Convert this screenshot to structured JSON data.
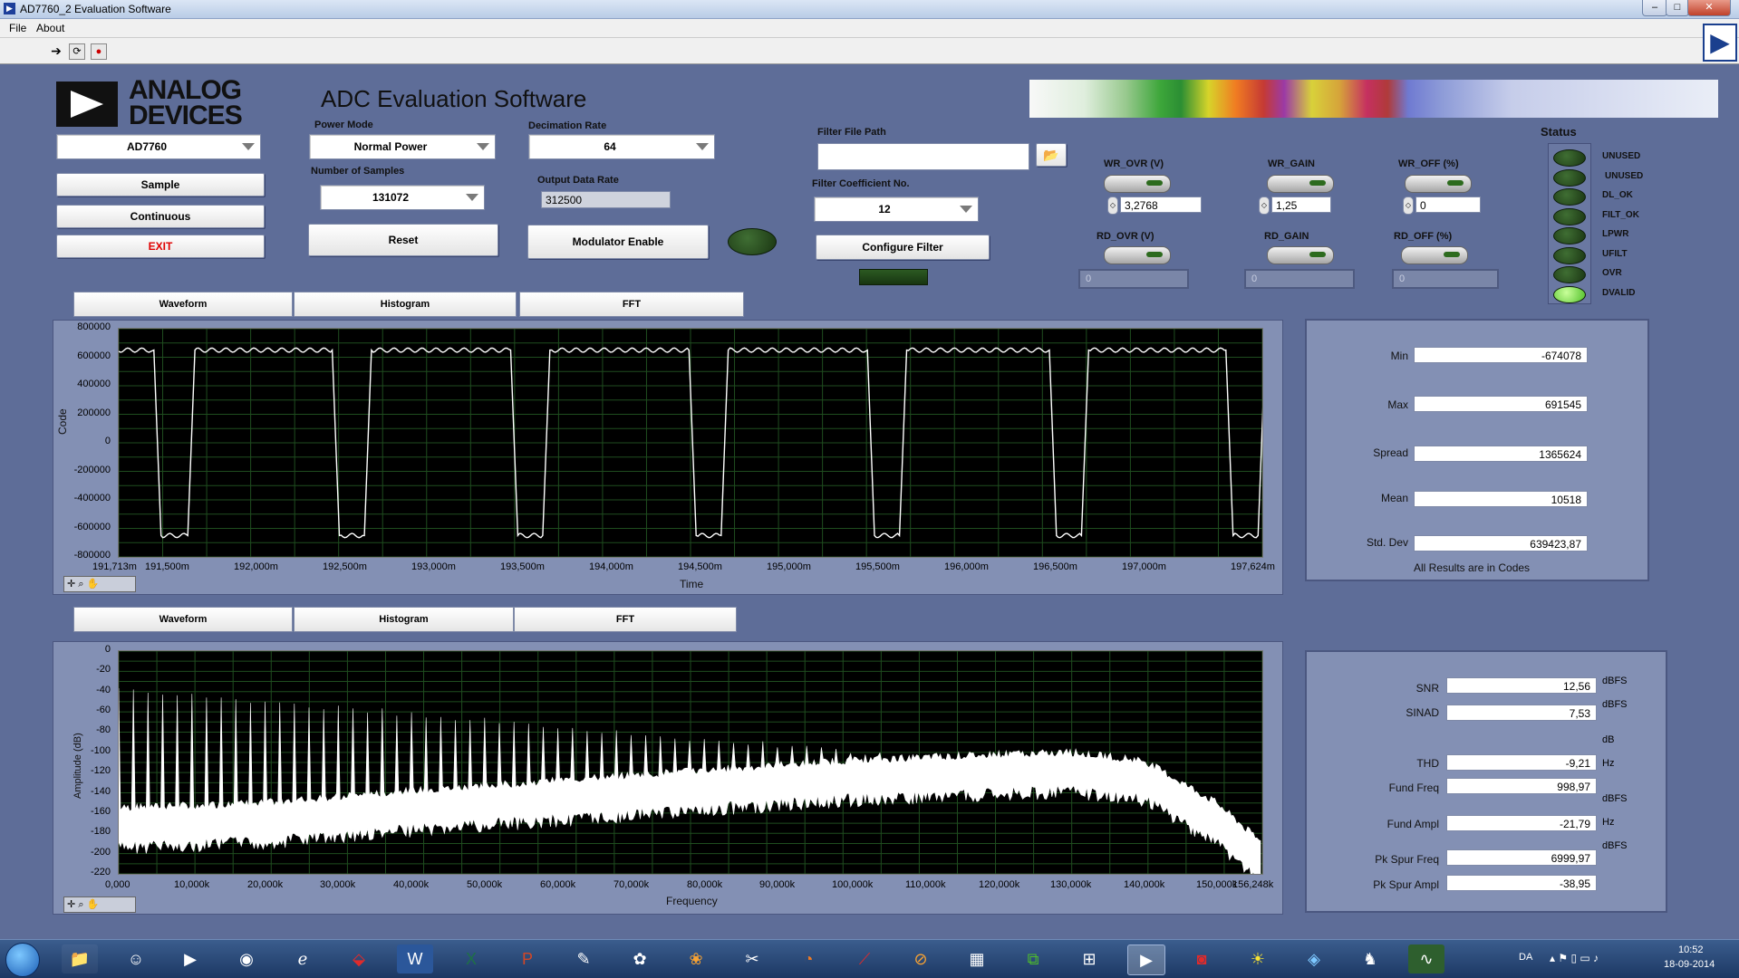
{
  "window": {
    "title": "AD7760_2 Evaluation Software"
  },
  "menu": [
    "File",
    "About"
  ],
  "header": {
    "logo_text": "ANALOG DEVICES",
    "app_title": "ADC Evaluation Software"
  },
  "controls": {
    "device": "AD7760",
    "sample_label": "Sample",
    "continuous_label": "Continuous",
    "exit_label": "EXIT",
    "power_mode_label": "Power Mode",
    "power_mode": "Normal Power",
    "num_samples_label": "Number of Samples",
    "num_samples": "131072",
    "reset_label": "Reset",
    "decimation_label": "Decimation Rate",
    "decimation": "64",
    "odr_label": "Output Data Rate",
    "odr": "312500",
    "modulator_label": "Modulator Enable",
    "filter_path_label": "Filter File Path",
    "filter_path": "",
    "filter_coeff_label": "Filter Coefficient No.",
    "filter_coeff": "12",
    "configure_label": "Configure Filter"
  },
  "registers": {
    "wr_ovr_label": "WR_OVR (V)",
    "wr_ovr": "3,2768",
    "wr_gain_label": "WR_GAIN",
    "wr_gain": "1,25",
    "wr_off_label": "WR_OFF (%)",
    "wr_off": "0",
    "rd_ovr_label": "RD_OVR (V)",
    "rd_ovr": "0",
    "rd_gain_label": "RD_GAIN",
    "rd_gain": "0",
    "rd_off_label": "RD_OFF (%)",
    "rd_off": "0"
  },
  "status": {
    "title": "Status",
    "items": [
      {
        "label": "UNUSED",
        "on": false
      },
      {
        "label": "UNUSED",
        "on": false
      },
      {
        "label": "DL_OK",
        "on": false
      },
      {
        "label": "FILT_OK",
        "on": false
      },
      {
        "label": "LPWR",
        "on": false
      },
      {
        "label": "UFILT",
        "on": false
      },
      {
        "label": "OVR",
        "on": false
      },
      {
        "label": "DVALID",
        "on": true
      }
    ]
  },
  "tabs_top": [
    "Waveform",
    "Histogram",
    "FFT"
  ],
  "tabs_bottom": [
    "Waveform",
    "Histogram",
    "FFT"
  ],
  "time_stats": {
    "min_label": "Min",
    "min": "-674078",
    "max_label": "Max",
    "max": "691545",
    "spread_label": "Spread",
    "spread": "1365624",
    "mean_label": "Mean",
    "mean": "10518",
    "std_label": "Std. Dev",
    "std": "639423,87",
    "note": "All Results are in Codes"
  },
  "fft_stats": {
    "snr_label": "SNR",
    "snr": "12,56",
    "snr_unit": "dBFS",
    "sinad_label": "SINAD",
    "sinad": "7,53",
    "sinad_unit": "dBFS",
    "thd_unit_pre": "dB",
    "thd_label": "THD",
    "thd": "-9,21",
    "thd_unit": "Hz",
    "fund_freq_label": "Fund Freq",
    "fund_freq": "998,97",
    "fund_freq_unit": "dBFS",
    "fund_ampl_label": "Fund Ampl",
    "fund_ampl": "-21,79",
    "fund_ampl_unit": "Hz",
    "pk_freq_unit_pre": "dBFS",
    "pk_freq_label": "Pk Spur Freq",
    "pk_freq": "6999,97",
    "pk_ampl_label": "Pk Spur Ampl",
    "pk_ampl": "-38,95"
  },
  "chart_data": [
    {
      "type": "line",
      "xlabel": "Time",
      "ylabel": "Code",
      "x_ticks": [
        "191,713m",
        "191,500m",
        "192,000m",
        "192,500m",
        "193,000m",
        "193,500m",
        "194,000m",
        "194,500m",
        "195,000m",
        "195,500m",
        "196,000m",
        "196,500m",
        "197,000m",
        "197,624m"
      ],
      "y_ticks": [
        "800000",
        "600000",
        "400000",
        "200000",
        "0",
        "-200000",
        "-400000",
        "-600000",
        "-800000"
      ],
      "ylim": [
        -800000,
        800000
      ],
      "xlim": [
        191.213,
        197.624
      ],
      "signal": "square wave, ~1 kHz",
      "high": 650000,
      "low": -650000,
      "rising_edges": [
        191.62,
        192.61,
        193.61,
        194.61,
        195.61,
        196.63,
        197.62
      ],
      "falling_edges": [
        191.43,
        192.43,
        193.43,
        194.43,
        195.43,
        196.45,
        197.44
      ],
      "grid": true
    },
    {
      "type": "area",
      "xlabel": "Frequency",
      "ylabel": "Amplitude (dB)",
      "x_ticks": [
        "0,000",
        "10,000k",
        "20,000k",
        "30,000k",
        "40,000k",
        "50,000k",
        "60,000k",
        "70,000k",
        "80,000k",
        "90,000k",
        "100,000k",
        "110,000k",
        "120,000k",
        "130,000k",
        "140,000k",
        "150,000k",
        "156,248k"
      ],
      "y_ticks": [
        "0",
        "-20",
        "-40",
        "-60",
        "-80",
        "-100",
        "-120",
        "-140",
        "-160",
        "-180",
        "-200",
        "-220"
      ],
      "ylim": [
        -220,
        0
      ],
      "xlim": [
        0,
        156248
      ],
      "noise_floor": {
        "x": [
          0,
          20000,
          40000,
          60000,
          80000,
          100000,
          120000,
          130000,
          140000,
          150000,
          156248
        ],
        "y": [
          -165,
          -160,
          -148,
          -138,
          -128,
          -118,
          -112,
          -110,
          -118,
          -160,
          -200
        ]
      },
      "harmonics_start_dbfs": -40,
      "grid": true
    }
  ],
  "taskbar": {
    "lang": "DA",
    "time": "10:52",
    "date": "18-09-2014"
  }
}
